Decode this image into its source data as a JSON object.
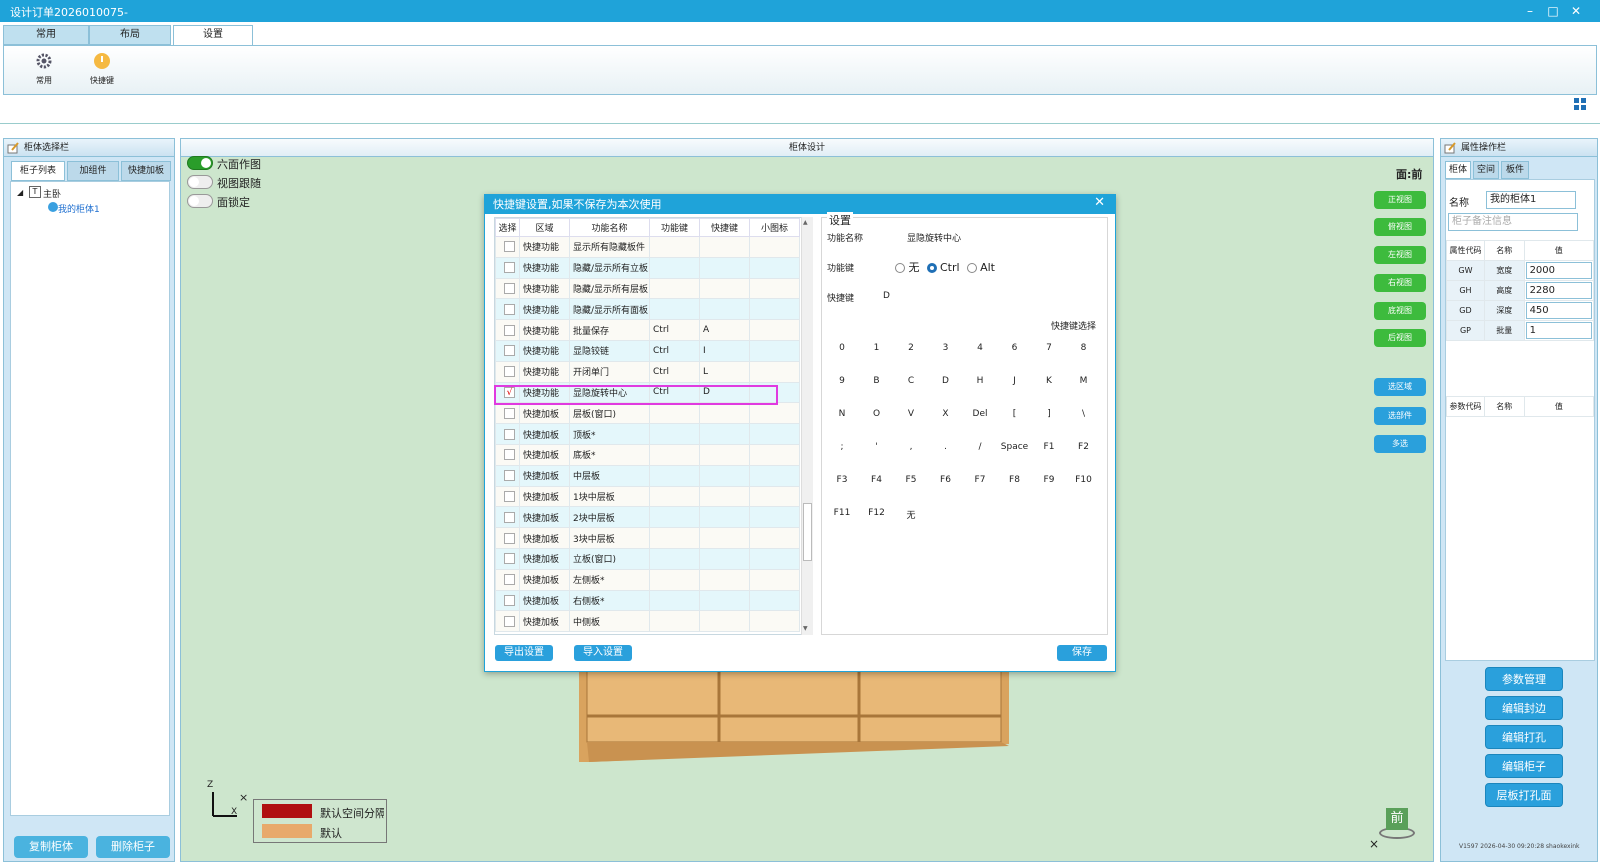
{
  "window": {
    "title": "设计订单2026010075-",
    "min": "–",
    "max": "□",
    "close": "✕"
  },
  "ribbon": {
    "tabs": [
      "常用",
      "布局",
      "设置"
    ],
    "buttons": [
      "常用",
      "快捷键"
    ]
  },
  "left": {
    "title": "柜体选择栏",
    "tabs": [
      "柜子列表",
      "加组件",
      "快捷加板"
    ],
    "tree": {
      "root": "主卧",
      "child": "我的柜体1"
    },
    "copy_btn": "复制柜体",
    "delete_btn": "删除柜子"
  },
  "center": {
    "title": "柜体设计",
    "toggles": [
      "六面作图",
      "视图跟随",
      "面锁定"
    ],
    "face_label": "面:前",
    "view_buttons": [
      "正视图",
      "俯视图",
      "左视图",
      "右视图",
      "底视图",
      "后视图"
    ],
    "select_buttons": [
      "选区域",
      "选部件",
      "多选"
    ],
    "legend": [
      "默认空间分隔",
      "默认"
    ],
    "axis": {
      "x": "X",
      "z": "Z"
    },
    "cube": "前"
  },
  "dialog": {
    "title": "快捷键设置,如果不保存为本次使用",
    "close": "✕",
    "headers": [
      "选择",
      "区域",
      "功能名称",
      "功能键",
      "快捷键",
      "小图标"
    ],
    "rows": [
      [
        "",
        "快捷功能",
        "显示所有隐藏板件",
        "",
        ""
      ],
      [
        "",
        "快捷功能",
        "隐藏/显示所有立板",
        "",
        ""
      ],
      [
        "",
        "快捷功能",
        "隐藏/显示所有层板",
        "",
        ""
      ],
      [
        "",
        "快捷功能",
        "隐藏/显示所有面板",
        "",
        ""
      ],
      [
        "",
        "快捷功能",
        "批量保存",
        "Ctrl",
        "A"
      ],
      [
        "",
        "快捷功能",
        "显隐铰链",
        "Ctrl",
        "I"
      ],
      [
        "",
        "快捷功能",
        "开闭单门",
        "Ctrl",
        "L"
      ],
      [
        "√",
        "快捷功能",
        "显隐旋转中心",
        "Ctrl",
        "D"
      ],
      [
        "",
        "快捷加板",
        "层板(窗口)",
        "",
        ""
      ],
      [
        "",
        "快捷加板",
        "顶板*",
        "",
        ""
      ],
      [
        "",
        "快捷加板",
        "底板*",
        "",
        ""
      ],
      [
        "",
        "快捷加板",
        "中层板",
        "",
        ""
      ],
      [
        "",
        "快捷加板",
        "1块中层板",
        "",
        ""
      ],
      [
        "",
        "快捷加板",
        "2块中层板",
        "",
        ""
      ],
      [
        "",
        "快捷加板",
        "3块中层板",
        "",
        ""
      ],
      [
        "",
        "快捷加板",
        "立板(窗口)",
        "",
        ""
      ],
      [
        "",
        "快捷加板",
        "左侧板*",
        "",
        ""
      ],
      [
        "",
        "快捷加板",
        "右侧板*",
        "",
        ""
      ],
      [
        "",
        "快捷加板",
        "中侧板",
        "",
        ""
      ]
    ],
    "settings": {
      "label": "设置",
      "func_name_label": "功能名称",
      "func_name": "显隐旋转中心",
      "func_key_label": "功能键",
      "radio": [
        "无",
        "Ctrl",
        "Alt"
      ],
      "shortcut_label": "快捷键",
      "shortcut": "D",
      "select_label": "快捷键选择",
      "keys": [
        "0",
        "1",
        "2",
        "3",
        "4",
        "6",
        "7",
        "8",
        "9",
        "B",
        "C",
        "D",
        "H",
        "J",
        "K",
        "M",
        "N",
        "O",
        "V",
        "X",
        "Del",
        "[",
        "]",
        "\\",
        ";",
        "'",
        ",",
        ".",
        "/",
        "Space",
        "F1",
        "F2",
        "F3",
        "F4",
        "F5",
        "F6",
        "F7",
        "F8",
        "F9",
        "F10",
        "F11",
        "F12",
        "无"
      ]
    },
    "export_btn": "导出设置",
    "import_btn": "导入设置",
    "save_btn": "保存"
  },
  "right": {
    "title": "属性操作栏",
    "tabs": [
      "柜体",
      "空间",
      "板件"
    ],
    "name_label": "名称",
    "name_value": "我的柜体1",
    "note_placeholder": "柜子备注信息",
    "attr_headers": [
      "属性代码",
      "名称",
      "值"
    ],
    "attrs": [
      [
        "GW",
        "宽度",
        "2000"
      ],
      [
        "GH",
        "高度",
        "2280"
      ],
      [
        "GD",
        "深度",
        "450"
      ],
      [
        "GP",
        "批量",
        "1"
      ]
    ],
    "param_headers": [
      "参数代码",
      "名称",
      "值"
    ],
    "buttons": [
      "参数管理",
      "编辑封边",
      "编辑打孔",
      "编辑柜子",
      "层板打孔面"
    ],
    "version": "V1597 2026-04-30 09:20:28 shaokexink"
  }
}
